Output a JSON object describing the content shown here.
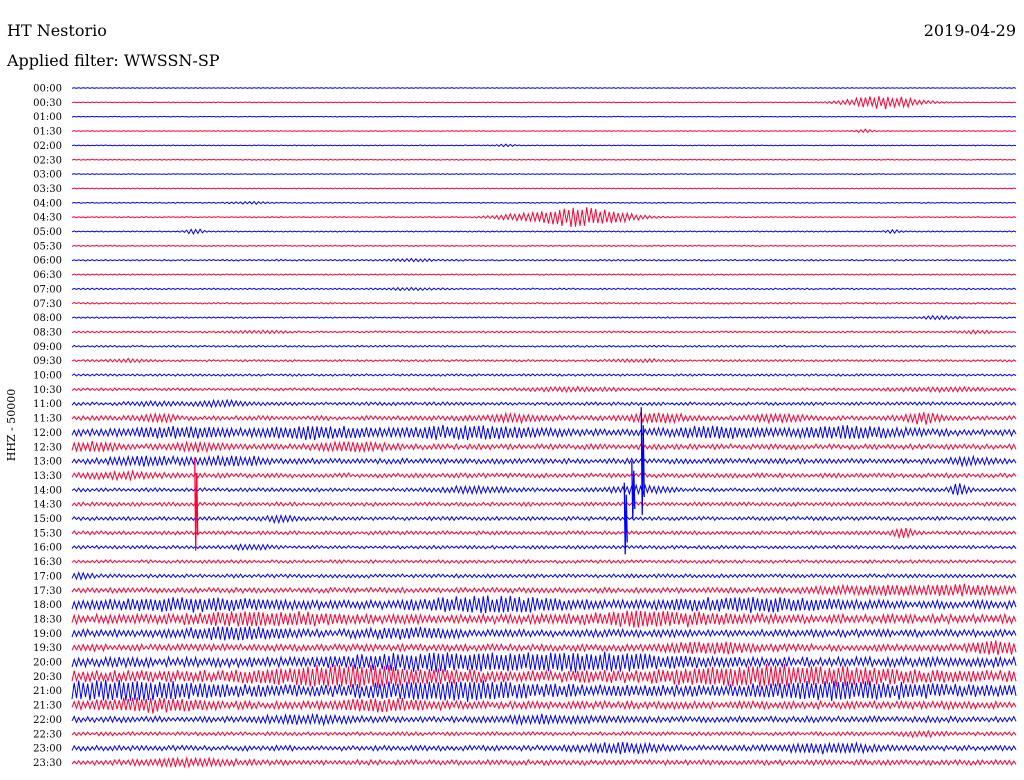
{
  "header": {
    "station": "HT Nestorio",
    "date": "2019-04-29",
    "filter_label": "Applied filter: WWSSN-SP"
  },
  "chart_data": {
    "type": "line",
    "title": "HT Nestorio",
    "subtitle": "Applied filter: WWSSN-SP",
    "ylabel": "HHZ - 50000",
    "grid": false,
    "colors": {
      "odd_trace": "#0000ff",
      "even_trace": "#ff0033",
      "text": "#000000",
      "background": "#ffffff"
    },
    "rows": [
      {
        "label": "00:00",
        "noise": 0.5,
        "events": []
      },
      {
        "label": "00:30",
        "noise": 0.5,
        "events": [
          {
            "t": 0.86,
            "amp": 12,
            "w": 0.04
          }
        ]
      },
      {
        "label": "01:00",
        "noise": 0.5,
        "events": []
      },
      {
        "label": "01:30",
        "noise": 0.5,
        "events": [
          {
            "t": 0.84,
            "amp": 3,
            "w": 0.01
          }
        ]
      },
      {
        "label": "02:00",
        "noise": 0.6,
        "events": [
          {
            "t": 0.46,
            "amp": 2,
            "w": 0.01
          }
        ]
      },
      {
        "label": "02:30",
        "noise": 0.6,
        "events": []
      },
      {
        "label": "03:00",
        "noise": 0.6,
        "events": []
      },
      {
        "label": "03:30",
        "noise": 0.6,
        "events": []
      },
      {
        "label": "04:00",
        "noise": 0.7,
        "events": [
          {
            "t": 0.19,
            "amp": 2,
            "w": 0.02
          }
        ]
      },
      {
        "label": "04:30",
        "noise": 0.7,
        "events": [
          {
            "t": 0.47,
            "amp": 4,
            "w": 0.03
          },
          {
            "t": 0.54,
            "amp": 18,
            "w": 0.05
          }
        ]
      },
      {
        "label": "05:00",
        "noise": 0.8,
        "events": [
          {
            "t": 0.13,
            "amp": 5,
            "w": 0.01
          },
          {
            "t": 0.87,
            "amp": 3,
            "w": 0.01
          }
        ]
      },
      {
        "label": "05:30",
        "noise": 0.8,
        "events": []
      },
      {
        "label": "06:00",
        "noise": 1.0,
        "events": [
          {
            "t": 0.36,
            "amp": 2,
            "w": 0.03
          }
        ]
      },
      {
        "label": "06:30",
        "noise": 0.9,
        "events": []
      },
      {
        "label": "07:00",
        "noise": 1.0,
        "events": [
          {
            "t": 0.36,
            "amp": 2,
            "w": 0.03
          }
        ]
      },
      {
        "label": "07:30",
        "noise": 1.0,
        "events": []
      },
      {
        "label": "08:00",
        "noise": 1.0,
        "events": [
          {
            "t": 0.92,
            "amp": 3,
            "w": 0.02
          }
        ]
      },
      {
        "label": "08:30",
        "noise": 1.2,
        "events": [
          {
            "t": 0.2,
            "amp": 2,
            "w": 0.03
          },
          {
            "t": 0.96,
            "amp": 2,
            "w": 0.02
          }
        ]
      },
      {
        "label": "09:00",
        "noise": 1.2,
        "events": []
      },
      {
        "label": "09:30",
        "noise": 1.4,
        "events": [
          {
            "t": 0.06,
            "amp": 2,
            "w": 0.02
          },
          {
            "t": 0.6,
            "amp": 2,
            "w": 0.03
          }
        ]
      },
      {
        "label": "10:00",
        "noise": 1.5,
        "events": []
      },
      {
        "label": "10:30",
        "noise": 1.8,
        "events": [
          {
            "t": 0.53,
            "amp": 3,
            "w": 0.05
          },
          {
            "t": 0.92,
            "amp": 3,
            "w": 0.05
          }
        ]
      },
      {
        "label": "11:00",
        "noise": 2.2,
        "events": [
          {
            "t": 0.09,
            "amp": 3,
            "w": 0.03
          },
          {
            "t": 0.16,
            "amp": 4,
            "w": 0.03
          }
        ]
      },
      {
        "label": "11:30",
        "noise": 3.0,
        "events": [
          {
            "t": 0.09,
            "amp": 5,
            "w": 0.02
          },
          {
            "t": 0.47,
            "amp": 5,
            "w": 0.04
          },
          {
            "t": 0.62,
            "amp": 8,
            "w": 0.03
          },
          {
            "t": 0.75,
            "amp": 6,
            "w": 0.03
          },
          {
            "t": 0.9,
            "amp": 9,
            "w": 0.02
          }
        ]
      },
      {
        "label": "12:00",
        "noise": 4.5,
        "events": [
          {
            "t": 0.11,
            "amp": 8,
            "w": 0.05
          },
          {
            "t": 0.25,
            "amp": 8,
            "w": 0.06
          },
          {
            "t": 0.42,
            "amp": 9,
            "w": 0.08
          },
          {
            "t": 0.68,
            "amp": 8,
            "w": 0.05
          },
          {
            "t": 0.82,
            "amp": 8,
            "w": 0.06
          }
        ]
      },
      {
        "label": "12:30",
        "noise": 3.5,
        "events": [
          {
            "t": 0.02,
            "amp": 6,
            "w": 0.03
          },
          {
            "t": 0.13,
            "amp": 6,
            "w": 0.03
          },
          {
            "t": 0.3,
            "amp": 6,
            "w": 0.04
          }
        ]
      },
      {
        "label": "13:00",
        "noise": 3.5,
        "events": [
          {
            "t": 0.08,
            "amp": 6,
            "w": 0.04
          },
          {
            "t": 0.17,
            "amp": 7,
            "w": 0.04
          },
          {
            "t": 0.95,
            "amp": 5,
            "w": 0.02
          }
        ]
      },
      {
        "label": "13:30",
        "noise": 3.0,
        "events": [
          {
            "t": 0.05,
            "amp": 5,
            "w": 0.04
          }
        ]
      },
      {
        "label": "14:00",
        "noise": 2.5,
        "events": [
          {
            "t": 0.43,
            "amp": 5,
            "w": 0.04
          },
          {
            "t": 0.6,
            "amp": 6,
            "w": 0.03
          },
          {
            "t": 0.94,
            "amp": 9,
            "w": 0.01
          }
        ]
      },
      {
        "label": "14:30",
        "noise": 2.5,
        "events": []
      },
      {
        "label": "15:00",
        "noise": 2.5,
        "events": [
          {
            "t": 0.22,
            "amp": 5,
            "w": 0.02
          }
        ]
      },
      {
        "label": "15:30",
        "noise": 2.5,
        "events": [
          {
            "t": 0.88,
            "amp": 9,
            "w": 0.01
          }
        ]
      },
      {
        "label": "16:00",
        "noise": 2.2,
        "events": [
          {
            "t": 0.19,
            "amp": 4,
            "w": 0.02
          }
        ]
      },
      {
        "label": "16:30",
        "noise": 2.2,
        "events": []
      },
      {
        "label": "17:00",
        "noise": 2.5,
        "events": [
          {
            "t": 0.01,
            "amp": 5,
            "w": 0.01
          }
        ]
      },
      {
        "label": "17:30",
        "noise": 3.5,
        "events": [
          {
            "t": 0.85,
            "amp": 5,
            "w": 0.08
          },
          {
            "t": 0.95,
            "amp": 6,
            "w": 0.06
          }
        ]
      },
      {
        "label": "18:00",
        "noise": 5.5,
        "events": [
          {
            "t": 0.12,
            "amp": 7,
            "w": 0.1
          },
          {
            "t": 0.44,
            "amp": 10,
            "w": 0.08
          },
          {
            "t": 0.72,
            "amp": 8,
            "w": 0.1
          }
        ]
      },
      {
        "label": "18:30",
        "noise": 6.0,
        "events": [
          {
            "t": 0.2,
            "amp": 8,
            "w": 0.08
          },
          {
            "t": 0.62,
            "amp": 9,
            "w": 0.08
          }
        ]
      },
      {
        "label": "19:00",
        "noise": 5.0,
        "events": [
          {
            "t": 0.17,
            "amp": 9,
            "w": 0.05
          },
          {
            "t": 0.35,
            "amp": 6,
            "w": 0.05
          }
        ]
      },
      {
        "label": "19:30",
        "noise": 4.5,
        "events": [
          {
            "t": 0.68,
            "amp": 7,
            "w": 0.05
          },
          {
            "t": 0.98,
            "amp": 9,
            "w": 0.03
          }
        ]
      },
      {
        "label": "20:00",
        "noise": 6.5,
        "events": [
          {
            "t": 0.38,
            "amp": 10,
            "w": 0.1
          },
          {
            "t": 0.55,
            "amp": 11,
            "w": 0.1
          }
        ]
      },
      {
        "label": "20:30",
        "noise": 8.0,
        "events": [
          {
            "t": 0.3,
            "amp": 12,
            "w": 0.1
          },
          {
            "t": 0.75,
            "amp": 12,
            "w": 0.12
          }
        ]
      },
      {
        "label": "21:00",
        "noise": 7.5,
        "events": [
          {
            "t": 0.05,
            "amp": 11,
            "w": 0.1
          },
          {
            "t": 0.4,
            "amp": 12,
            "w": 0.1
          },
          {
            "t": 0.82,
            "amp": 10,
            "w": 0.1
          }
        ]
      },
      {
        "label": "21:30",
        "noise": 5.0,
        "events": [
          {
            "t": 0.08,
            "amp": 9,
            "w": 0.06
          },
          {
            "t": 0.33,
            "amp": 8,
            "w": 0.05
          }
        ]
      },
      {
        "label": "22:00",
        "noise": 4.0,
        "events": [
          {
            "t": 0.25,
            "amp": 5,
            "w": 0.05
          },
          {
            "t": 0.5,
            "amp": 5,
            "w": 0.05
          }
        ]
      },
      {
        "label": "22:30",
        "noise": 2.5,
        "events": [
          {
            "t": 0.9,
            "amp": 4,
            "w": 0.02
          }
        ]
      },
      {
        "label": "23:00",
        "noise": 3.5,
        "events": [
          {
            "t": 0.58,
            "amp": 7,
            "w": 0.05
          },
          {
            "t": 0.8,
            "amp": 7,
            "w": 0.05
          }
        ]
      },
      {
        "label": "23:30",
        "noise": 3.5,
        "events": [
          {
            "t": 0.12,
            "amp": 5,
            "w": 0.05
          }
        ]
      }
    ],
    "spikes": [
      {
        "row": 29,
        "t": 0.13,
        "rows_span": 6.5
      },
      {
        "row": 28,
        "t": 0.593,
        "rows_span": 4
      },
      {
        "row": 30,
        "t": 0.585,
        "rows_span": 5
      },
      {
        "row": 26,
        "t": 0.603,
        "rows_span": 7.5
      }
    ]
  }
}
